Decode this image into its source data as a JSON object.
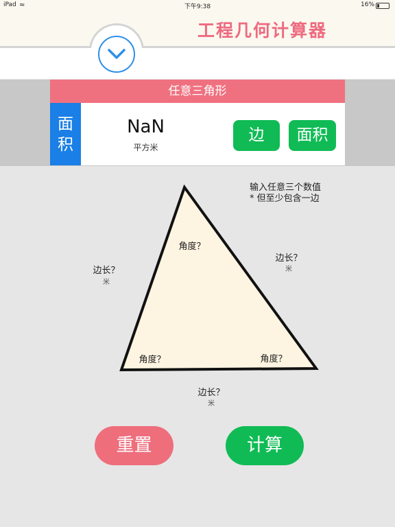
{
  "status_bar": {
    "device": "iPad",
    "time": "下午9:38",
    "battery": "16%"
  },
  "header": {
    "title": "工程几何计算器"
  },
  "result": {
    "shape_name": "任意三角形",
    "mode_label_1": "面",
    "mode_label_2": "积",
    "value": "NaN",
    "unit": "平方米",
    "side_button": "边",
    "area_button": "面积"
  },
  "hint": {
    "line1": "输入任意三个数值",
    "line2": "* 但至少包含一边"
  },
  "triangle": {
    "angle_top": "角度？",
    "angle_left": "角度？",
    "angle_right": "角度？",
    "side_left": "边长？",
    "side_left_unit": "米",
    "side_right": "边长？",
    "side_right_unit": "米",
    "side_bottom": "边长？",
    "side_bottom_unit": "米"
  },
  "actions": {
    "reset": "重置",
    "calculate": "计算"
  },
  "colors": {
    "title": "#ee6a7f",
    "banner": "#ef7180",
    "mode": "#1a7fe6",
    "green": "#10bb55",
    "triangle_fill": "#fdf4e1"
  }
}
